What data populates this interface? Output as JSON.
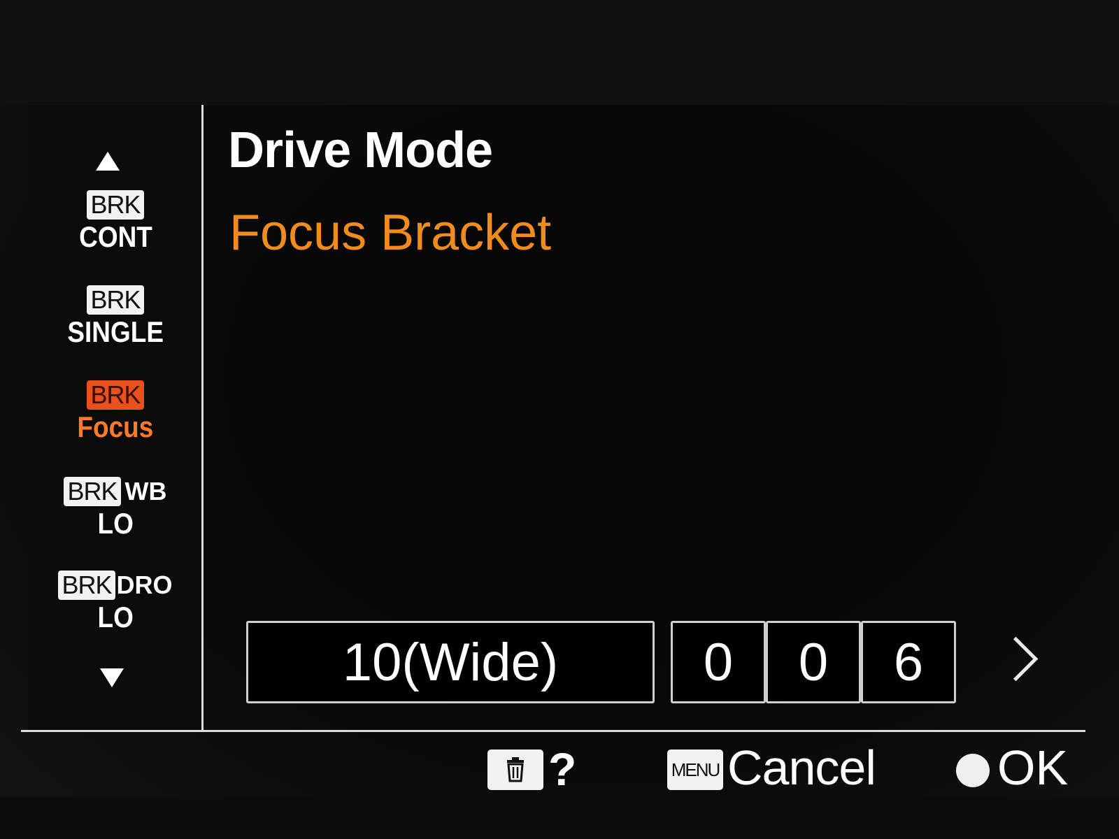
{
  "sidebar": {
    "items": [
      {
        "badge": "BRK",
        "label": "CONT",
        "suffix": ""
      },
      {
        "badge": "BRK",
        "label": "SINGLE",
        "suffix": ""
      },
      {
        "badge": "BRK",
        "label": "Focus",
        "suffix": "",
        "selected": true
      },
      {
        "badge": "BRK",
        "label": "LO",
        "suffix": "WB"
      },
      {
        "badge": "BRK",
        "label": "LO",
        "suffix": "DRO"
      }
    ]
  },
  "main": {
    "title": "Drive Mode",
    "subtitle": "Focus Bracket",
    "range_value": "10(Wide)",
    "digits": [
      "0",
      "0",
      "6"
    ]
  },
  "footer": {
    "help_label": "?",
    "menu_key": "MENU",
    "cancel_label": "Cancel",
    "ok_label": "OK"
  },
  "colors": {
    "accent": "#f08c1e",
    "selected_badge": "#e8501e",
    "text": "#ffffff"
  },
  "icons": [
    "up-arrow-icon",
    "down-arrow-icon",
    "chevron-right-icon",
    "trash-icon",
    "center-button-icon"
  ]
}
